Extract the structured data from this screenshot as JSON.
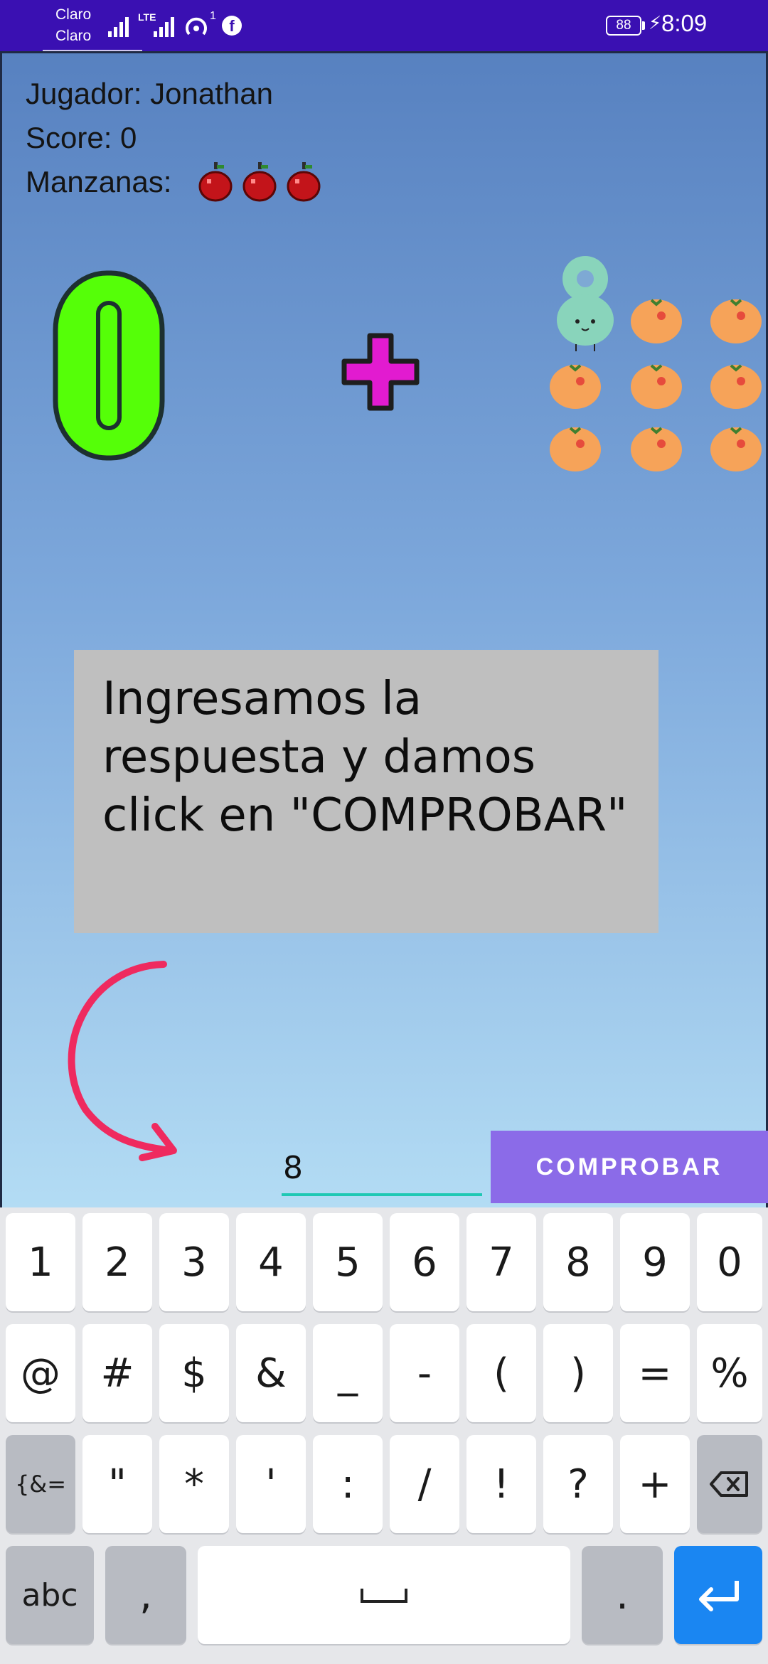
{
  "status_bar": {
    "carrier_1": "Claro",
    "carrier_2": "Claro",
    "network_type": "LTE",
    "hotspot_count": "1",
    "facebook_badge": "f",
    "battery": "88",
    "time": "8:09",
    "bar_color": "#3a10b2"
  },
  "game": {
    "player_line": "Jugador: Jonathan",
    "score_line": "Score: 0",
    "apples_label": "Manzanas:",
    "apples_count": 3,
    "operand_left": "0",
    "operator": "+",
    "operand_right": "8",
    "operand_right_objects": 8,
    "object_icon": "orange-icon",
    "instruction": "Ingresamos la respuesta y damos click en \"COMPROBAR\"",
    "answer_value": "8",
    "check_button": "COMPROBAR",
    "colors": {
      "zero": "#55ff08",
      "plus": "#e21bd0",
      "eight": "#89d4bb",
      "button": "#8b6be8",
      "arrow": "#ef2a5f",
      "input_underline": "#1fc8b4"
    }
  },
  "keyboard": {
    "row1": [
      "1",
      "2",
      "3",
      "4",
      "5",
      "6",
      "7",
      "8",
      "9",
      "0"
    ],
    "row2": [
      "@",
      "#",
      "$",
      "&",
      "_",
      "-",
      "(",
      ")",
      "=",
      "%"
    ],
    "row3_left": "{&=",
    "row3": [
      "\"",
      "*",
      "'",
      ":",
      "/",
      "!",
      "?",
      "+"
    ],
    "row3_right": "backspace-icon",
    "row4_left": "abc",
    "row4_comma": ",",
    "row4_space": "space-icon",
    "row4_period": ".",
    "row4_enter": "enter-icon"
  }
}
